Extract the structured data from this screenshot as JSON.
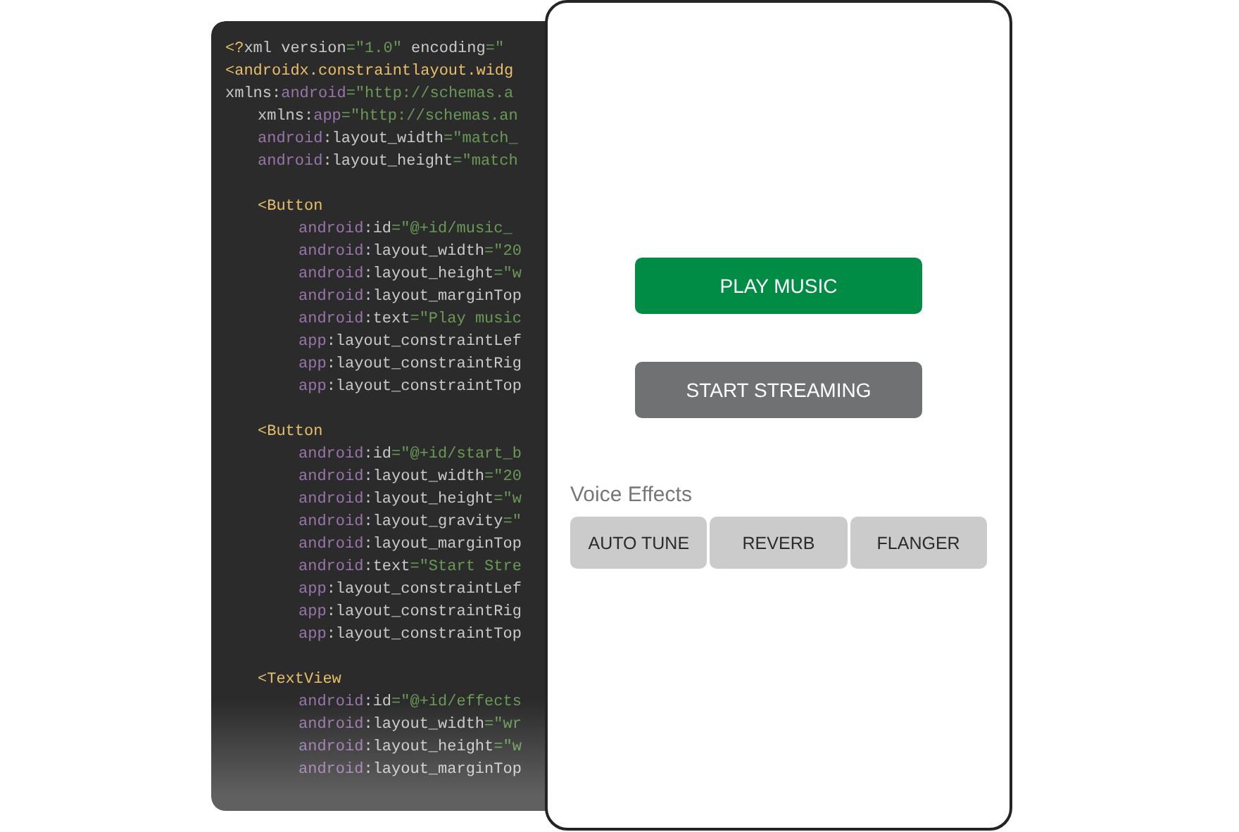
{
  "code_editor": {
    "lines": [
      {
        "tokens": [
          {
            "kind": "tag",
            "text": "<?"
          },
          {
            "kind": "plain",
            "text": "xml version"
          },
          {
            "kind": "value",
            "text": "=\"1.0\""
          },
          {
            "kind": "plain",
            "text": " encoding"
          },
          {
            "kind": "value",
            "text": "=\""
          }
        ]
      },
      {
        "tokens": [
          {
            "kind": "tag",
            "text": "<androidx.constraintlayout.widg"
          }
        ]
      },
      {
        "tokens": [
          {
            "kind": "plain",
            "text": "xmlns:"
          },
          {
            "kind": "ns",
            "text": "android"
          },
          {
            "kind": "value",
            "text": "=\"http://schemas.a"
          }
        ],
        "children": [
          {
            "tokens": [
              {
                "kind": "plain",
                "text": "xmlns:"
              },
              {
                "kind": "ns",
                "text": "app"
              },
              {
                "kind": "value",
                "text": "=\"http://schemas.an"
              }
            ]
          },
          {
            "tokens": [
              {
                "kind": "ns",
                "text": "android"
              },
              {
                "kind": "plain",
                "text": ":layout_width"
              },
              {
                "kind": "value",
                "text": "=\"match_"
              }
            ]
          },
          {
            "tokens": [
              {
                "kind": "ns",
                "text": "android"
              },
              {
                "kind": "plain",
                "text": ":layout_height"
              },
              {
                "kind": "value",
                "text": "=\"match"
              }
            ]
          },
          {
            "tokens": [
              {
                "kind": "tag",
                "text": "<Button"
              }
            ],
            "children": [
              {
                "tokens": [
                  {
                    "kind": "ns",
                    "text": "android"
                  },
                  {
                    "kind": "plain",
                    "text": ":id"
                  },
                  {
                    "kind": "value",
                    "text": "=\"@+id/music_"
                  }
                ]
              },
              {
                "tokens": [
                  {
                    "kind": "ns",
                    "text": "android"
                  },
                  {
                    "kind": "plain",
                    "text": ":layout_width"
                  },
                  {
                    "kind": "value",
                    "text": "=\"20"
                  }
                ]
              },
              {
                "tokens": [
                  {
                    "kind": "ns",
                    "text": "android"
                  },
                  {
                    "kind": "plain",
                    "text": ":layout_height"
                  },
                  {
                    "kind": "value",
                    "text": "=\"w"
                  }
                ]
              },
              {
                "tokens": [
                  {
                    "kind": "ns",
                    "text": "android"
                  },
                  {
                    "kind": "plain",
                    "text": ":layout_marginTop"
                  }
                ]
              },
              {
                "tokens": [
                  {
                    "kind": "ns",
                    "text": "android"
                  },
                  {
                    "kind": "plain",
                    "text": ":text"
                  },
                  {
                    "kind": "value",
                    "text": "=\"Play music"
                  }
                ]
              },
              {
                "tokens": [
                  {
                    "kind": "ns",
                    "text": "app"
                  },
                  {
                    "kind": "plain",
                    "text": ":layout_constraintLef"
                  }
                ]
              },
              {
                "tokens": [
                  {
                    "kind": "ns",
                    "text": "app"
                  },
                  {
                    "kind": "plain",
                    "text": ":layout_constraintRig"
                  }
                ]
              },
              {
                "tokens": [
                  {
                    "kind": "ns",
                    "text": "app"
                  },
                  {
                    "kind": "plain",
                    "text": ":layout_constraintTop"
                  }
                ]
              }
            ]
          },
          {
            "tokens": [
              {
                "kind": "tag",
                "text": "<Button"
              }
            ],
            "children": [
              {
                "tokens": [
                  {
                    "kind": "ns",
                    "text": "android"
                  },
                  {
                    "kind": "plain",
                    "text": ":id"
                  },
                  {
                    "kind": "value",
                    "text": "=\"@+id/start_b"
                  }
                ]
              },
              {
                "tokens": [
                  {
                    "kind": "ns",
                    "text": "android"
                  },
                  {
                    "kind": "plain",
                    "text": ":layout_width"
                  },
                  {
                    "kind": "value",
                    "text": "=\"20"
                  }
                ]
              },
              {
                "tokens": [
                  {
                    "kind": "ns",
                    "text": "android"
                  },
                  {
                    "kind": "plain",
                    "text": ":layout_height"
                  },
                  {
                    "kind": "value",
                    "text": "=\"w"
                  }
                ]
              },
              {
                "tokens": [
                  {
                    "kind": "ns",
                    "text": "android"
                  },
                  {
                    "kind": "plain",
                    "text": ":layout_gravity"
                  },
                  {
                    "kind": "value",
                    "text": "=\""
                  }
                ]
              },
              {
                "tokens": [
                  {
                    "kind": "ns",
                    "text": "android"
                  },
                  {
                    "kind": "plain",
                    "text": ":layout_marginTop"
                  }
                ]
              },
              {
                "tokens": [
                  {
                    "kind": "ns",
                    "text": "android"
                  },
                  {
                    "kind": "plain",
                    "text": ":text"
                  },
                  {
                    "kind": "value",
                    "text": "=\"Start Stre"
                  }
                ]
              },
              {
                "tokens": [
                  {
                    "kind": "ns",
                    "text": "app"
                  },
                  {
                    "kind": "plain",
                    "text": ":layout_constraintLef"
                  }
                ]
              },
              {
                "tokens": [
                  {
                    "kind": "ns",
                    "text": "app"
                  },
                  {
                    "kind": "plain",
                    "text": ":layout_constraintRig"
                  }
                ]
              },
              {
                "tokens": [
                  {
                    "kind": "ns",
                    "text": "app"
                  },
                  {
                    "kind": "plain",
                    "text": ":layout_constraintTop"
                  }
                ]
              }
            ]
          },
          {
            "tokens": [
              {
                "kind": "tag",
                "text": "<TextView"
              }
            ],
            "children": [
              {
                "tokens": [
                  {
                    "kind": "ns",
                    "text": "android"
                  },
                  {
                    "kind": "plain",
                    "text": ":id"
                  },
                  {
                    "kind": "value",
                    "text": "=\"@+id/effects"
                  }
                ]
              },
              {
                "tokens": [
                  {
                    "kind": "ns",
                    "text": "android"
                  },
                  {
                    "kind": "plain",
                    "text": ":layout_width"
                  },
                  {
                    "kind": "value",
                    "text": "=\"wr"
                  }
                ]
              },
              {
                "tokens": [
                  {
                    "kind": "ns",
                    "text": "android"
                  },
                  {
                    "kind": "plain",
                    "text": ":layout_height"
                  },
                  {
                    "kind": "value",
                    "text": "=\"w"
                  }
                ]
              },
              {
                "tokens": [
                  {
                    "kind": "ns",
                    "text": "android"
                  },
                  {
                    "kind": "plain",
                    "text": ":layout_marginTop"
                  }
                ]
              }
            ]
          }
        ]
      }
    ]
  },
  "phone_preview": {
    "buttons": [
      {
        "label": "PLAY MUSIC",
        "kind": "primary"
      },
      {
        "label": "START STREAMING",
        "kind": "secondary"
      }
    ],
    "section_label": "Voice Effects",
    "effect_buttons": [
      {
        "label": "AUTO TUNE"
      },
      {
        "label": "REVERB"
      },
      {
        "label": "FLANGER"
      }
    ]
  }
}
